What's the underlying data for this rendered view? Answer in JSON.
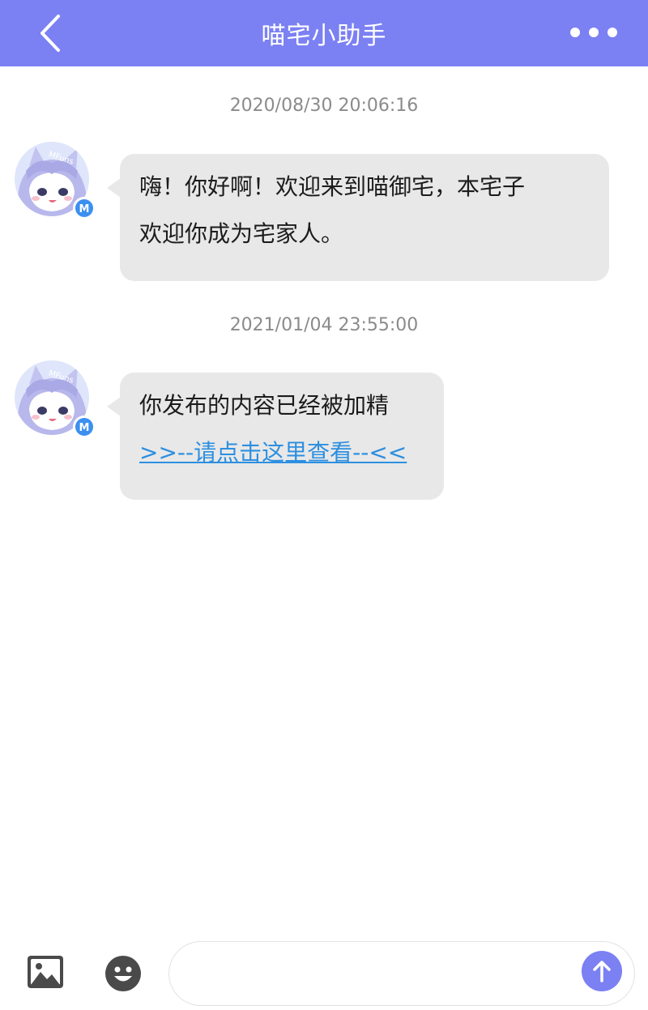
{
  "header": {
    "title": "喵宅小助手",
    "back_icon": "chevron-left-icon",
    "more_icon": "more-horizontal-icon",
    "background": "#7b80f3"
  },
  "messages": [
    {
      "timestamp": "2020/08/30 20:06:16",
      "sender": "喵宅小助手",
      "avatar_badge": "M",
      "avatar_caption": "MFuns",
      "lines": [
        "嗨！你好啊！欢迎来到喵御宅，本宅子",
        "欢迎你成为宅家人。"
      ]
    },
    {
      "timestamp": "2021/01/04 23:55:00",
      "sender": "喵宅小助手",
      "avatar_badge": "M",
      "avatar_caption": "MFuns",
      "lines": [
        "你发布的内容已经被加精"
      ],
      "link_text": ">>--请点击这里查看--<<"
    }
  ],
  "input_bar": {
    "image_icon": "image-icon",
    "emoji_icon": "emoji-icon",
    "send_icon": "arrow-up-icon",
    "input_value": "",
    "input_placeholder": ""
  },
  "colors": {
    "accent": "#7b80f3",
    "bubble": "#e8e8e8",
    "link": "#2d8fe0",
    "timestamp": "#8b8b8b"
  }
}
